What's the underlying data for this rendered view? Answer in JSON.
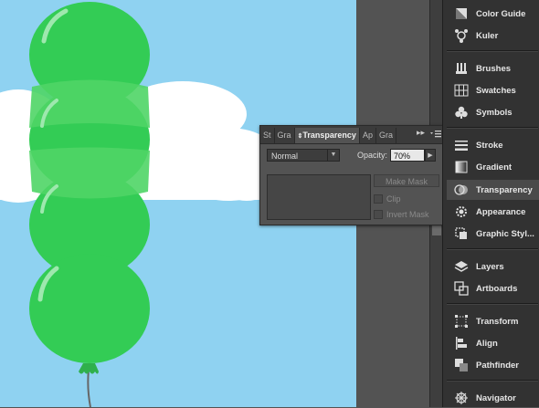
{
  "colors": {
    "sky": "#8fd2f1",
    "cloud": "#ffffff",
    "balloon": "#33cc55",
    "balloon_overlap": "#4fd566",
    "panel_bg": "#535353",
    "dock_bg": "#323232"
  },
  "transparency_panel": {
    "tabs": [
      {
        "label": "St",
        "active": false
      },
      {
        "label": "Gra",
        "active": false
      },
      {
        "label": "Transparency",
        "active": true
      },
      {
        "label": "Ap",
        "active": false
      },
      {
        "label": "Gra",
        "active": false
      }
    ],
    "overflow_label": "▸▸",
    "blend_mode": "Normal",
    "opacity_label": "Opacity:",
    "opacity_value": "70%",
    "make_mask_label": "Make Mask",
    "clip_label": "Clip",
    "invert_mask_label": "Invert Mask"
  },
  "dock": {
    "items": [
      {
        "label": "Color Guide",
        "icon": "color-guide-icon"
      },
      {
        "label": "Kuler",
        "icon": "kuler-icon"
      },
      {
        "label": "Brushes",
        "icon": "brushes-icon"
      },
      {
        "label": "Swatches",
        "icon": "swatches-icon"
      },
      {
        "label": "Symbols",
        "icon": "symbols-icon"
      },
      {
        "label": "Stroke",
        "icon": "stroke-icon"
      },
      {
        "label": "Gradient",
        "icon": "gradient-icon"
      },
      {
        "label": "Transparency",
        "icon": "transparency-icon",
        "active": true
      },
      {
        "label": "Appearance",
        "icon": "appearance-icon"
      },
      {
        "label": "Graphic Styl...",
        "icon": "graphic-styles-icon"
      },
      {
        "label": "Layers",
        "icon": "layers-icon"
      },
      {
        "label": "Artboards",
        "icon": "artboards-icon"
      },
      {
        "label": "Transform",
        "icon": "transform-icon"
      },
      {
        "label": "Align",
        "icon": "align-icon"
      },
      {
        "label": "Pathfinder",
        "icon": "pathfinder-icon"
      },
      {
        "label": "Navigator",
        "icon": "navigator-icon"
      }
    ]
  }
}
